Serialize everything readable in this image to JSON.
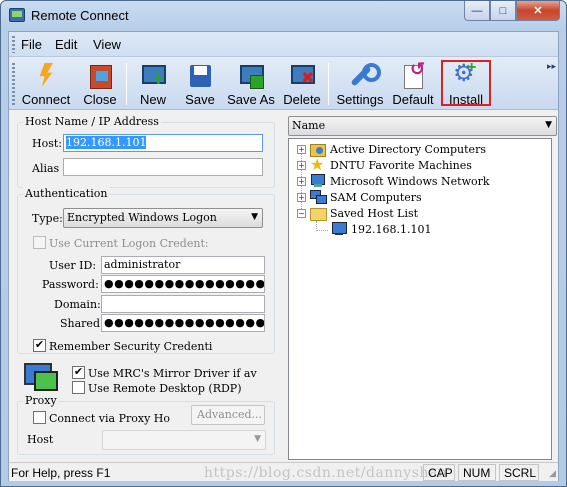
{
  "window": {
    "title": "Remote Connect",
    "minimize_glyph": "—",
    "maximize_glyph": "□",
    "close_glyph": "✕"
  },
  "menu": {
    "items": [
      "File",
      "Edit",
      "View"
    ]
  },
  "toolbar": {
    "buttons": [
      {
        "label": "Connect",
        "icon": "lightning-icon"
      },
      {
        "label": "Close",
        "icon": "door-exit-icon"
      },
      {
        "label": "New",
        "icon": "new-computer-icon"
      },
      {
        "label": "Save",
        "icon": "floppy-disk-icon"
      },
      {
        "label": "Save As",
        "icon": "save-as-icon"
      },
      {
        "label": "Delete",
        "icon": "delete-computer-icon"
      },
      {
        "label": "Settings",
        "icon": "wrench-icon"
      },
      {
        "label": "Default",
        "icon": "reset-default-icon"
      },
      {
        "label": "Install",
        "icon": "install-gear-icon"
      }
    ],
    "highlight_color": "#e02020"
  },
  "host_group": {
    "title": "Host Name / IP Address",
    "host_label": "Host:",
    "host_value": "192.168.1.101",
    "alias_label": "Alias",
    "alias_value": ""
  },
  "auth_group": {
    "title": "Authentication",
    "type_label": "Type:",
    "type_value": "Encrypted Windows Logon",
    "use_current_label": "Use Current Logon Credent:",
    "user_id_label": "User ID:",
    "user_id_value": "administrator",
    "password_label": "Password:",
    "password_value": "●●●●●●●●●●●●●●●●",
    "domain_label": "Domain:",
    "domain_value": "",
    "shared_label": "Shared",
    "shared_value": "●●●●●●●●●●●●●●●●",
    "remember_label": "Remember Security Credenti",
    "remember_checked": true
  },
  "options": {
    "mirror_label": "Use MRC's Mirror Driver if av",
    "mirror_checked": true,
    "rdp_label": "Use Remote Desktop (RDP)",
    "rdp_checked": false
  },
  "proxy": {
    "title": "Proxy",
    "connect_label": "Connect via Proxy Ho",
    "advanced_label": "Advanced...",
    "host_label": "Host"
  },
  "tree": {
    "column": "Name",
    "nodes": [
      {
        "label": "Active Directory Computers",
        "expander": "+"
      },
      {
        "label": "DNTU Favorite Machines",
        "expander": "+"
      },
      {
        "label": "Microsoft Windows Network",
        "expander": "+"
      },
      {
        "label": "SAM Computers",
        "expander": "+"
      },
      {
        "label": "Saved Host List",
        "expander": "−"
      }
    ],
    "child": {
      "label": "192.168.1.101"
    }
  },
  "status": {
    "help": "For Help, press F1",
    "cap": "CAP",
    "num": "NUM",
    "scrl": "SCRL",
    "watermark": "https://blog.csdn.net/dannyshan"
  }
}
